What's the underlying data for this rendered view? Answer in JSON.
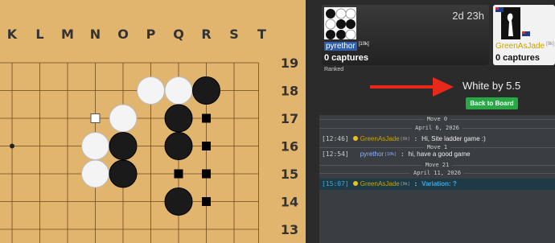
{
  "board": {
    "column_labels": [
      "K",
      "L",
      "M",
      "N",
      "O",
      "P",
      "Q",
      "R",
      "S",
      "T"
    ],
    "row_labels": [
      "19",
      "18",
      "17",
      "16",
      "15",
      "14",
      "13"
    ],
    "black_stones": [
      [
        "R",
        18
      ],
      [
        "Q",
        17
      ],
      [
        "O",
        16
      ],
      [
        "Q",
        16
      ],
      [
        "O",
        15
      ],
      [
        "Q",
        14
      ]
    ],
    "white_stones": [
      [
        "P",
        18
      ],
      [
        "Q",
        18
      ],
      [
        "O",
        17
      ],
      [
        "N",
        16
      ],
      [
        "N",
        15
      ]
    ],
    "black_territory_marks": [
      [
        "R",
        17
      ],
      [
        "R",
        16
      ],
      [
        "Q",
        15
      ],
      [
        "R",
        15
      ],
      [
        "R",
        14
      ]
    ],
    "white_territory_marks": [
      [
        "N",
        17
      ]
    ],
    "star_points": [
      [
        "K",
        16
      ]
    ],
    "colors": {
      "wood": "#e2b56e",
      "line": "#6b4a1f"
    }
  },
  "players": {
    "white": {
      "name": "pyrethor",
      "rank": "[10k]",
      "captures": "0 captures",
      "clock": "2d 23h",
      "name_color": "#ffffff"
    },
    "black": {
      "name": "GreenAsJade",
      "rank": "[9k]",
      "captures": "0 captures",
      "name_color": "#c9a400"
    }
  },
  "ranked_label": "Ranked",
  "result": {
    "text": "White by 5.5",
    "back_button": "Back to Board",
    "arrow_color": "#e8281b"
  },
  "chat": {
    "separators": [
      {
        "label": "Move 0"
      },
      {
        "label": "April 6, 2026"
      },
      {
        "label": "Move 1"
      },
      {
        "label": "Move 21"
      },
      {
        "label": "April 11, 2026"
      }
    ],
    "messages": [
      {
        "time": "[12:46]",
        "dot": true,
        "nick": "GreenAsJade",
        "rank": "[9k]",
        "sep": ":",
        "text": "Hi, Site ladder game :)"
      },
      {
        "time": "[12:54]",
        "dot": false,
        "nick": "pyrethor",
        "rank": "[10k]",
        "sep": ":",
        "text": "hi, have a good game"
      },
      {
        "time": "[15:07]",
        "dot": true,
        "nick": "GreenAsJade",
        "rank": "[9k]",
        "sep": ":",
        "text": "Variation: ?"
      }
    ]
  }
}
